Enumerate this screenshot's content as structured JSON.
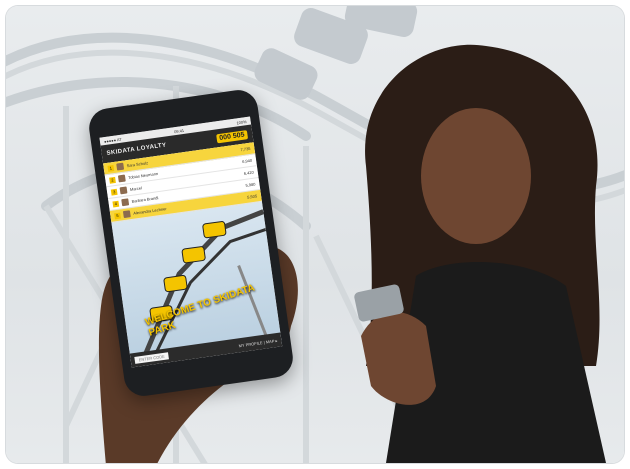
{
  "app": {
    "title": "SKIDATA LOYALTY",
    "points": "000 505",
    "status_carrier": "●●●●● AT",
    "status_time": "09:41",
    "status_battery": "100%"
  },
  "leaderboard": {
    "rows": [
      {
        "rank": "1",
        "name": "Sara Schulz",
        "score": "7,735"
      },
      {
        "rank": "2",
        "name": "Tobias Neumann",
        "score": "6,940"
      },
      {
        "rank": "3",
        "name": "Marcel",
        "score": "6,420"
      },
      {
        "rank": "4",
        "name": "Barbara Brandl",
        "score": "5,980"
      },
      {
        "rank": "5",
        "name": "Alexandra Lechner",
        "score": "5,505"
      }
    ]
  },
  "banner": {
    "welcome": "WELCOME TO SKIDATA PARK"
  },
  "bottom": {
    "field": "ENTER CODE",
    "menu": "MY PROFILE | MAP ▸"
  },
  "colors": {
    "accent": "#f4c400",
    "dark": "#2a2a2a"
  }
}
